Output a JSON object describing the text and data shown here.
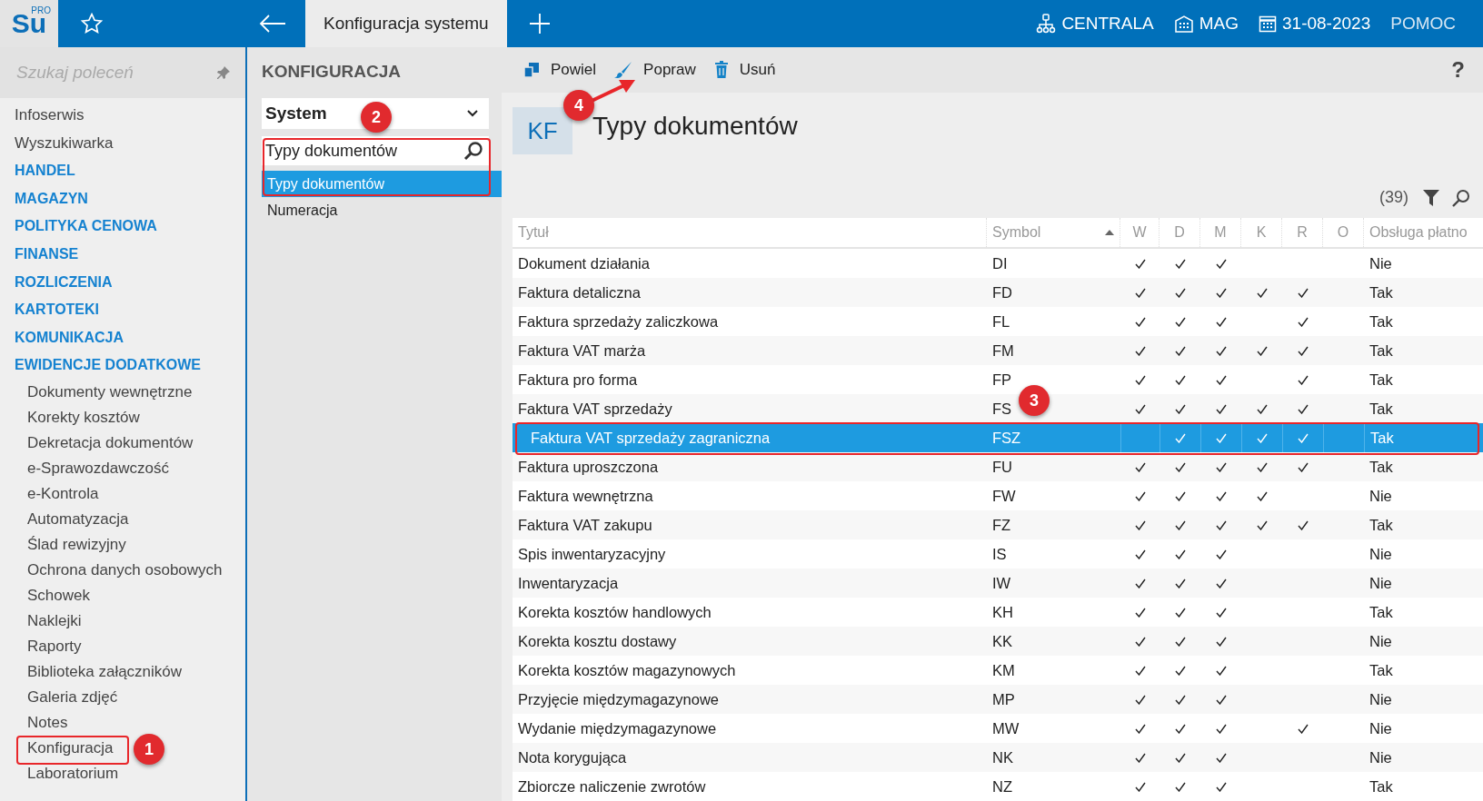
{
  "topbar": {
    "logo": "Su",
    "logo_badge": "PRO",
    "tab": "Konfiguracja systemu",
    "right": [
      {
        "kind": "branch",
        "label": "CENTRALA"
      },
      {
        "kind": "warehouse",
        "label": "MAG"
      },
      {
        "kind": "date",
        "label": "31-08-2023"
      },
      {
        "kind": "help",
        "label": "POMOC"
      }
    ]
  },
  "sidebar": {
    "search": {
      "placeholder": "Szukaj poleceń"
    },
    "items": [
      {
        "kind": "plain",
        "label": "Infoserwis"
      },
      {
        "kind": "plain",
        "label": "Wyszukiwarka"
      },
      {
        "kind": "section",
        "label": "HANDEL"
      },
      {
        "kind": "section",
        "label": "MAGAZYN"
      },
      {
        "kind": "section",
        "label": "POLITYKA CENOWA"
      },
      {
        "kind": "section",
        "label": "FINANSE"
      },
      {
        "kind": "section",
        "label": "ROZLICZENIA"
      },
      {
        "kind": "section",
        "label": "KARTOTEKI"
      },
      {
        "kind": "section",
        "label": "KOMUNIKACJA"
      },
      {
        "kind": "section",
        "label": "EWIDENCJE DODATKOWE"
      },
      {
        "kind": "sub",
        "label": "Dokumenty wewnętrzne"
      },
      {
        "kind": "sub",
        "label": "Korekty kosztów"
      },
      {
        "kind": "sub",
        "label": "Dekretacja dokumentów"
      },
      {
        "kind": "sub",
        "label": "e-Sprawozdawczość"
      },
      {
        "kind": "sub",
        "label": "e-Kontrola"
      },
      {
        "kind": "sub",
        "label": "Automatyzacja"
      },
      {
        "kind": "sub",
        "label": "Ślad rewizyjny"
      },
      {
        "kind": "sub",
        "label": "Ochrona danych osobowych"
      },
      {
        "kind": "sub",
        "label": "Schowek"
      },
      {
        "kind": "sub",
        "label": "Naklejki"
      },
      {
        "kind": "sub",
        "label": "Raporty"
      },
      {
        "kind": "sub",
        "label": "Biblioteka załączników"
      },
      {
        "kind": "sub",
        "label": "Galeria zdjęć"
      },
      {
        "kind": "sub",
        "label": "Notes"
      },
      {
        "kind": "sub",
        "label": "Konfiguracja"
      },
      {
        "kind": "sub",
        "label": "Laboratorium"
      }
    ]
  },
  "config_panel": {
    "title": "KONFIGURACJA",
    "dropdown": "System",
    "search": "Typy dokumentów",
    "items": [
      {
        "label": "Typy dokumentów",
        "selected": true
      },
      {
        "label": "Numeracja",
        "selected": false
      }
    ]
  },
  "toolbar": [
    {
      "kind": "copy",
      "label": "Powiel"
    },
    {
      "kind": "edit",
      "label": "Popraw"
    },
    {
      "kind": "delete",
      "label": "Usuń"
    }
  ],
  "help": "?",
  "header": {
    "badge": "KF",
    "title": "Typy dokumentów",
    "count": "(39)"
  },
  "table": {
    "columns": [
      {
        "label": "Tytuł",
        "sorted": false
      },
      {
        "label": "Symbol",
        "sorted": true
      },
      {
        "label": "W",
        "sorted": false
      },
      {
        "label": "D",
        "sorted": false
      },
      {
        "label": "M",
        "sorted": false
      },
      {
        "label": "K",
        "sorted": false
      },
      {
        "label": "R",
        "sorted": false
      },
      {
        "label": "O",
        "sorted": false
      },
      {
        "label": "Obsługa płatno",
        "sorted": false
      }
    ],
    "rows": [
      {
        "title": "Dokument działania",
        "symbol": "DI",
        "marks": [
          true,
          true,
          true,
          false,
          false,
          false
        ],
        "payment": "Nie",
        "selected": false
      },
      {
        "title": "Faktura detaliczna",
        "symbol": "FD",
        "marks": [
          true,
          true,
          true,
          true,
          true,
          false
        ],
        "payment": "Tak",
        "selected": false
      },
      {
        "title": "Faktura sprzedaży zaliczkowa",
        "symbol": "FL",
        "marks": [
          true,
          true,
          true,
          false,
          true,
          false
        ],
        "payment": "Tak",
        "selected": false
      },
      {
        "title": "Faktura VAT marża",
        "symbol": "FM",
        "marks": [
          true,
          true,
          true,
          true,
          true,
          false
        ],
        "payment": "Tak",
        "selected": false
      },
      {
        "title": "Faktura pro forma",
        "symbol": "FP",
        "marks": [
          true,
          true,
          true,
          false,
          true,
          false
        ],
        "payment": "Tak",
        "selected": false
      },
      {
        "title": "Faktura VAT sprzedaży",
        "symbol": "FS",
        "marks": [
          true,
          true,
          true,
          true,
          true,
          false
        ],
        "payment": "Tak",
        "selected": false
      },
      {
        "title": "Faktura VAT sprzedaży zagraniczna",
        "symbol": "FSZ",
        "marks": [
          false,
          true,
          true,
          true,
          true,
          false
        ],
        "payment": "Tak",
        "selected": true
      },
      {
        "title": "Faktura uproszczona",
        "symbol": "FU",
        "marks": [
          true,
          true,
          true,
          true,
          true,
          false
        ],
        "payment": "Tak",
        "selected": false
      },
      {
        "title": "Faktura wewnętrzna",
        "symbol": "FW",
        "marks": [
          true,
          true,
          true,
          true,
          false,
          false
        ],
        "payment": "Nie",
        "selected": false
      },
      {
        "title": "Faktura VAT zakupu",
        "symbol": "FZ",
        "marks": [
          true,
          true,
          true,
          true,
          true,
          false
        ],
        "payment": "Tak",
        "selected": false
      },
      {
        "title": "Spis inwentaryzacyjny",
        "symbol": "IS",
        "marks": [
          true,
          true,
          true,
          false,
          false,
          false
        ],
        "payment": "Nie",
        "selected": false
      },
      {
        "title": "Inwentaryzacja",
        "symbol": "IW",
        "marks": [
          true,
          true,
          true,
          false,
          false,
          false
        ],
        "payment": "Nie",
        "selected": false
      },
      {
        "title": "Korekta kosztów handlowych",
        "symbol": "KH",
        "marks": [
          true,
          true,
          true,
          false,
          false,
          false
        ],
        "payment": "Tak",
        "selected": false
      },
      {
        "title": "Korekta kosztu dostawy",
        "symbol": "KK",
        "marks": [
          true,
          true,
          true,
          false,
          false,
          false
        ],
        "payment": "Nie",
        "selected": false
      },
      {
        "title": "Korekta kosztów magazynowych",
        "symbol": "KM",
        "marks": [
          true,
          true,
          true,
          false,
          false,
          false
        ],
        "payment": "Tak",
        "selected": false
      },
      {
        "title": "Przyjęcie międzymagazynowe",
        "symbol": "MP",
        "marks": [
          true,
          true,
          true,
          false,
          false,
          false
        ],
        "payment": "Nie",
        "selected": false
      },
      {
        "title": "Wydanie międzymagazynowe",
        "symbol": "MW",
        "marks": [
          true,
          true,
          true,
          false,
          true,
          false
        ],
        "payment": "Nie",
        "selected": false
      },
      {
        "title": "Nota korygująca",
        "symbol": "NK",
        "marks": [
          true,
          true,
          true,
          false,
          false,
          false
        ],
        "payment": "Nie",
        "selected": false
      },
      {
        "title": "Zbiorcze naliczenie zwrotów",
        "symbol": "NZ",
        "marks": [
          true,
          true,
          true,
          false,
          false,
          false
        ],
        "payment": "Tak",
        "selected": false
      }
    ]
  },
  "annotations": [
    {
      "number": "1"
    },
    {
      "number": "2"
    },
    {
      "number": "3"
    },
    {
      "number": "4"
    }
  ]
}
